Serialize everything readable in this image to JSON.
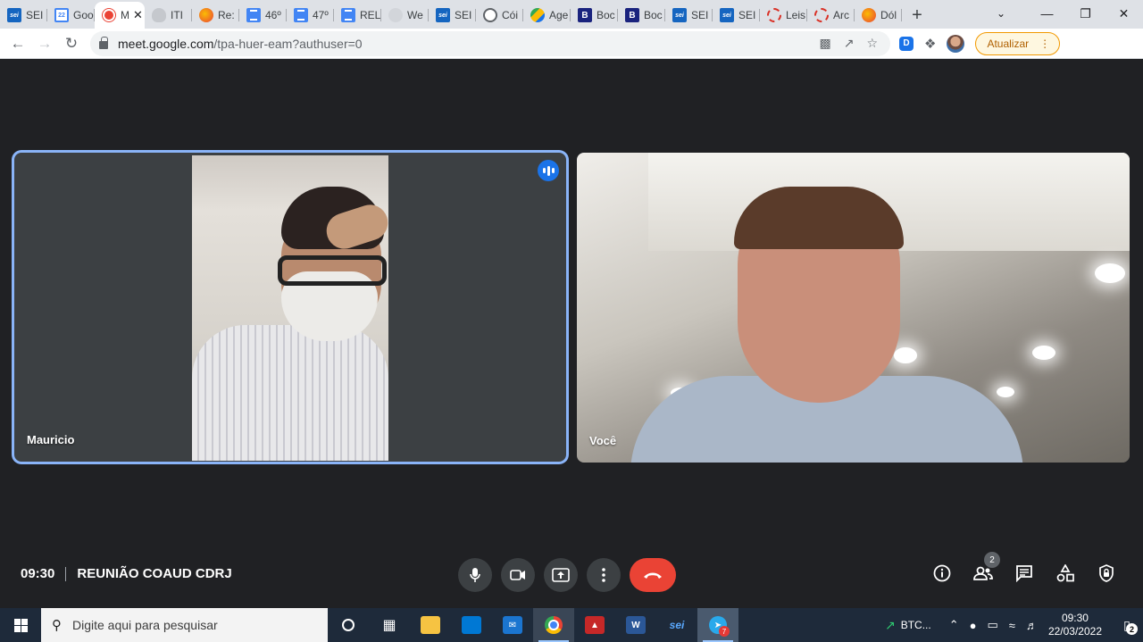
{
  "browser": {
    "tabs": [
      {
        "label": "SEI",
        "icon": "sei"
      },
      {
        "label": "Goo",
        "icon": "cal",
        "badge": "22"
      },
      {
        "label": "M",
        "icon": "rec",
        "active": true
      },
      {
        "label": "ITI",
        "icon": "shield"
      },
      {
        "label": "Re:",
        "icon": "orange"
      },
      {
        "label": "46º",
        "icon": "doc"
      },
      {
        "label": "47º",
        "icon": "doc"
      },
      {
        "label": "REL",
        "icon": "doc"
      },
      {
        "label": "We",
        "icon": "gray"
      },
      {
        "label": "SEI",
        "icon": "sei"
      },
      {
        "label": "Cói",
        "icon": "globe"
      },
      {
        "label": "Age",
        "icon": "ag"
      },
      {
        "label": "Boc",
        "icon": "bold"
      },
      {
        "label": "Boc",
        "icon": "bold"
      },
      {
        "label": "SEI",
        "icon": "sei"
      },
      {
        "label": "SEI",
        "icon": "sei"
      },
      {
        "label": "Leis",
        "icon": "ring"
      },
      {
        "label": "Arc",
        "icon": "ring"
      },
      {
        "label": "Dól",
        "icon": "orange"
      }
    ],
    "fav_text": {
      "sei": "sei",
      "bold": "B"
    },
    "new_tab": "+",
    "url_host": "meet.google.com",
    "url_path": "/tpa-huer-eam?authuser=0",
    "extension_letter": "D",
    "update_label": "Atualizar"
  },
  "meet": {
    "participants": [
      {
        "name": "Mauricio",
        "speaking": true
      },
      {
        "name": "Você",
        "speaking": false
      }
    ],
    "time": "09:30",
    "meeting_title": "REUNIÃO COAUD CDRJ",
    "people_count": "2",
    "colors": {
      "background": "#202124",
      "tile": "#3c4043",
      "hangup": "#ea4335",
      "speaking_outline": "#8ab4f8"
    }
  },
  "taskbar": {
    "search_placeholder": "Digite aqui para pesquisar",
    "tray_btc": "BTC...",
    "clock_time": "09:30",
    "clock_date": "22/03/2022",
    "telegram_badge": "7",
    "notification_count": "2"
  }
}
